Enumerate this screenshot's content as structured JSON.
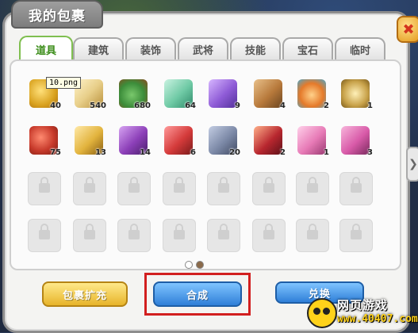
{
  "window": {
    "title": "我的包裹",
    "close_symbol": "✖"
  },
  "tabs": [
    {
      "label": "道具",
      "active": true
    },
    {
      "label": "建筑",
      "active": false
    },
    {
      "label": "装饰",
      "active": false
    },
    {
      "label": "武将",
      "active": false
    },
    {
      "label": "技能",
      "active": false
    },
    {
      "label": "宝石",
      "active": false
    },
    {
      "label": "临时",
      "active": false
    }
  ],
  "tooltip": "10.png",
  "items_row1": [
    {
      "name": "golden-horn-item",
      "count": "40",
      "color": "#d9a21f"
    },
    {
      "name": "scroll-item",
      "count": "540",
      "color": "#e8cf8a"
    },
    {
      "name": "money-bag-item",
      "count": "680",
      "color": "#3c8d3a"
    },
    {
      "name": "green-tag-item",
      "count": "64",
      "color": "#6ec9a4"
    },
    {
      "name": "mystery-box-item",
      "count": "9",
      "color": "#8e5bd6"
    },
    {
      "name": "shovel-item",
      "count": "4",
      "color": "#b7793b"
    },
    {
      "name": "medal-item",
      "count": "2",
      "color": "#e57a2a"
    },
    {
      "name": "coins-item",
      "count": "1",
      "color": "#c8a24a"
    }
  ],
  "items_row2": [
    {
      "name": "red-horn-item",
      "count": "75",
      "color": "#c73a2b"
    },
    {
      "name": "treasure-chest-item",
      "count": "13",
      "color": "#e2b33d"
    },
    {
      "name": "purple-gift-item",
      "count": "14",
      "color": "#8c3fb8"
    },
    {
      "name": "red-gift-item",
      "count": "6",
      "color": "#d43a3a"
    },
    {
      "name": "gray-gift-item",
      "count": "20",
      "color": "#7b88a6"
    },
    {
      "name": "red-bow-gift-item",
      "count": "2",
      "color": "#b8272f"
    },
    {
      "name": "pink-gift-item",
      "count": "1",
      "color": "#e77ab6"
    },
    {
      "name": "pink-box-item",
      "count": "3",
      "color": "#d85aa8"
    }
  ],
  "buttons": {
    "expand": "包裹扩充",
    "combine": "合成",
    "exchange": "兑换"
  },
  "page_dots": {
    "count": 2,
    "active_index": 1
  },
  "watermark": {
    "line1": "网页游戏",
    "line2": "www.40407.com"
  }
}
